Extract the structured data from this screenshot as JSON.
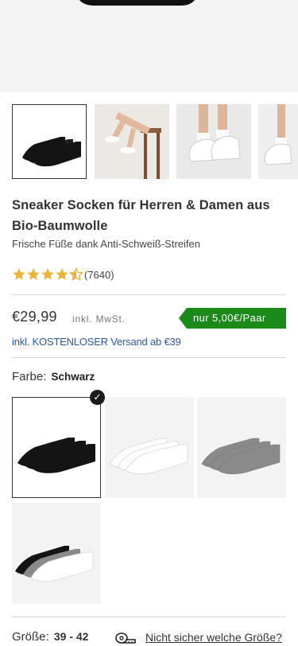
{
  "product": {
    "title": "Sneaker Socken für Herren & Damen aus Bio-Baumwolle",
    "subtitle": "Frische Füße dank Anti-Schweiß-Streifen",
    "rating": {
      "value": 4.5,
      "max": 5,
      "count": "(7640)"
    },
    "price": "€29,99",
    "vat_note": "inkl. MwSt.",
    "pair_price_badge": "nur 5,00€/Paar",
    "shipping_note": "inkl. KOSTENLOSER Versand ab €39"
  },
  "gallery": {
    "thumbnails": [
      {
        "name": "black-socks-pack",
        "selected": true
      },
      {
        "name": "white-socks-on-legs-chair",
        "selected": false
      },
      {
        "name": "white-socks-with-sneakers",
        "selected": false
      },
      {
        "name": "socks-with-sneakers-partial",
        "selected": false
      }
    ]
  },
  "color": {
    "label": "Farbe:",
    "selected_value": "Schwarz",
    "options": [
      {
        "name": "Schwarz",
        "selected": true
      },
      {
        "name": "Weiß",
        "selected": false
      },
      {
        "name": "Grau",
        "selected": false
      },
      {
        "name": "Mix",
        "selected": false
      }
    ]
  },
  "size": {
    "label": "Größe:",
    "selected_value": "39 - 42",
    "help_link": "Nicht sicher welche Größe?",
    "help_icon": "measuring-tape-icon"
  },
  "colors": {
    "badge_green": "#1a8a1a",
    "link_blue": "#2c5aa6",
    "star_gold": "#e9b53a"
  }
}
